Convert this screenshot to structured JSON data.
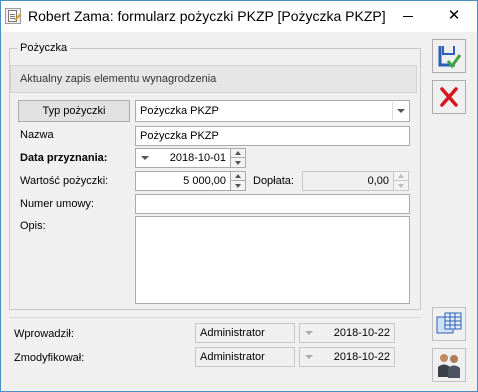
{
  "window": {
    "title": "Robert Zama: formularz pożyczki PKZP [Pożyczka PKZP]",
    "minimize_glyph": "—",
    "close_glyph": "✕"
  },
  "group": {
    "legend": "Pożyczka",
    "info_text": "Aktualny zapis elementu wynagrodzenia"
  },
  "form": {
    "loan_type_button": "Typ pożyczki",
    "loan_type_value": "Pożyczka PKZP",
    "name_label": "Nazwa",
    "name_value": "Pożyczka PKZP",
    "grant_date_label": "Data przyznania:",
    "grant_date_value": "2018-10-01",
    "loan_amount_label": "Wartość pożyczki:",
    "loan_amount_value": "5 000,00",
    "surcharge_label": "Dopłata:",
    "surcharge_value": "0,00",
    "contract_number_label": "Numer umowy:",
    "contract_number_value": "",
    "description_label": "Opis:",
    "description_value": ""
  },
  "footer": {
    "entered_by_label": "Wprowadził:",
    "entered_by_user": "Administrator",
    "entered_date": "2018-10-22",
    "modified_by_label": "Zmodyfikował:",
    "modified_by_user": "Administrator",
    "modified_date": "2018-10-22"
  },
  "icons": {
    "save": "save-icon",
    "cancel": "cancel-icon",
    "calculator": "table-icon",
    "people": "people-icon"
  },
  "colors": {
    "save_blue": "#2b5fb8",
    "save_check": "#3fa33f",
    "cancel_red": "#d8161e",
    "border_blue": "#4a8fc4"
  }
}
